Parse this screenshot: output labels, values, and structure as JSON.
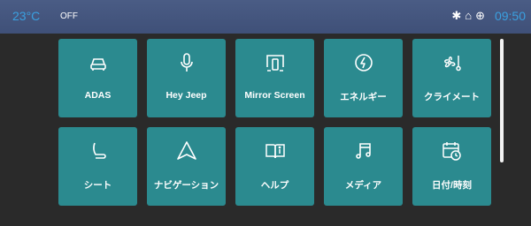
{
  "status": {
    "temperature": "23°C",
    "ac": "OFF",
    "time": "09:50",
    "icons": [
      "bluetooth-icon",
      "vehicle-status-icon",
      "location-icon"
    ]
  },
  "apps": [
    {
      "label": "ADAS",
      "icon": "car-icon"
    },
    {
      "label": "Hey Jeep",
      "icon": "microphone-icon"
    },
    {
      "label": "Mirror Screen",
      "icon": "phone-mirror-icon"
    },
    {
      "label": "エネルギー",
      "icon": "energy-icon"
    },
    {
      "label": "クライメート",
      "icon": "fan-icon"
    },
    {
      "label": "シート",
      "icon": "seat-icon"
    },
    {
      "label": "ナビゲーション",
      "icon": "navigation-icon"
    },
    {
      "label": "ヘルプ",
      "icon": "help-book-icon"
    },
    {
      "label": "メディア",
      "icon": "music-icon"
    },
    {
      "label": "日付/時刻",
      "icon": "calendar-clock-icon"
    }
  ],
  "colors": {
    "tile": "#2b8a8f",
    "statusbar": "#4a5c85",
    "accent": "#3aa0e0",
    "background": "#2a2a2a"
  }
}
